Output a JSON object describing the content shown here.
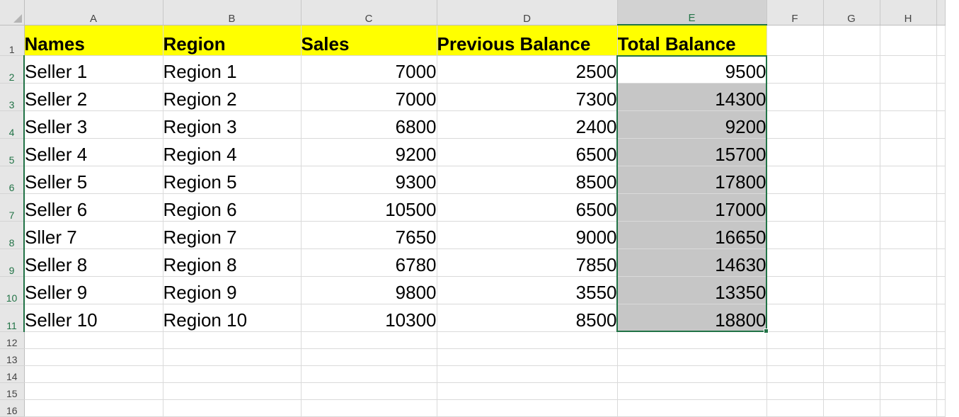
{
  "columns": [
    "A",
    "B",
    "C",
    "D",
    "E",
    "F",
    "G",
    "H"
  ],
  "header_row": {
    "row_number": "1",
    "cells": [
      "Names",
      "Region",
      "Sales",
      "Previous Balance",
      "Total Balance"
    ]
  },
  "data_rows": [
    {
      "row": "2",
      "name": "Seller 1",
      "region": "Region 1",
      "sales": "7000",
      "prev": "2500",
      "total": "9500"
    },
    {
      "row": "3",
      "name": "Seller 2",
      "region": "Region 2",
      "sales": "7000",
      "prev": "7300",
      "total": "14300"
    },
    {
      "row": "4",
      "name": "Seller 3",
      "region": "Region 3",
      "sales": "6800",
      "prev": "2400",
      "total": "9200"
    },
    {
      "row": "5",
      "name": "Seller 4",
      "region": "Region 4",
      "sales": "9200",
      "prev": "6500",
      "total": "15700"
    },
    {
      "row": "6",
      "name": "Seller 5",
      "region": "Region 5",
      "sales": "9300",
      "prev": "8500",
      "total": "17800"
    },
    {
      "row": "7",
      "name": "Seller 6",
      "region": "Region 6",
      "sales": "10500",
      "prev": "6500",
      "total": "17000"
    },
    {
      "row": "8",
      "name": "Sller 7",
      "region": "Region 7",
      "sales": "7650",
      "prev": "9000",
      "total": "16650"
    },
    {
      "row": "9",
      "name": "Seller 8",
      "region": "Region 8",
      "sales": "6780",
      "prev": "7850",
      "total": "14630"
    },
    {
      "row": "10",
      "name": "Seller 9",
      "region": "Region 9",
      "sales": "9800",
      "prev": "3550",
      "total": "13350"
    },
    {
      "row": "11",
      "name": "Seller 10",
      "region": "Region 10",
      "sales": "10300",
      "prev": "8500",
      "total": "18800"
    }
  ],
  "empty_rows": [
    "12",
    "13",
    "14",
    "15",
    "16"
  ],
  "colors": {
    "header_fill": "#ffff00",
    "selection_fill": "#c6c6c6",
    "selection_border": "#217346"
  }
}
